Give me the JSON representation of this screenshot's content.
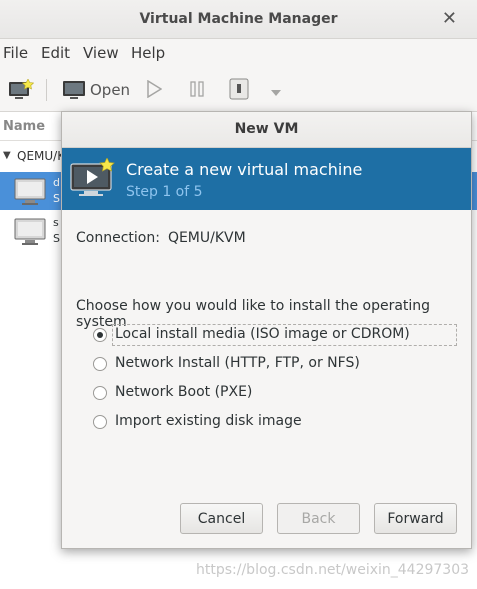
{
  "window": {
    "title": "Virtual Machine Manager",
    "close_icon": "close-icon"
  },
  "menu": [
    "File",
    "Edit",
    "View",
    "Help"
  ],
  "toolbar": {
    "new_icon": "new-vm-icon",
    "open_label": "Open",
    "run_icon": "play-icon",
    "pause_icon": "pause-icon",
    "shutdown_icon": "power-icon",
    "dropdown_icon": "chevron-down-icon"
  },
  "vm_list": {
    "column_name": "Name",
    "connection_label": "QEMU/K",
    "rows": [
      {
        "name": "d",
        "status": "S",
        "selected": true
      },
      {
        "name": "s",
        "status": "S",
        "selected": false
      }
    ]
  },
  "dialog": {
    "title": "New VM",
    "banner_title": "Create a new virtual machine",
    "banner_step": "Step 1 of 5",
    "connection_label": "Connection:",
    "connection_value": "QEMU/KVM",
    "prompt": "Choose how you would like to install the operating system",
    "options": [
      {
        "label": "Local install media (ISO image or CDROM)",
        "selected": true
      },
      {
        "label": "Network Install (HTTP, FTP, or NFS)",
        "selected": false
      },
      {
        "label": "Network Boot (PXE)",
        "selected": false
      },
      {
        "label": "Import existing disk image",
        "selected": false
      }
    ],
    "buttons": {
      "cancel": "Cancel",
      "back": "Back",
      "forward": "Forward"
    }
  },
  "watermark": "https://blog.csdn.net/weixin_44297303",
  "colors": {
    "banner": "#1e6fa5",
    "selection": "#4a90d9",
    "step_text": "#8fc4ee"
  }
}
